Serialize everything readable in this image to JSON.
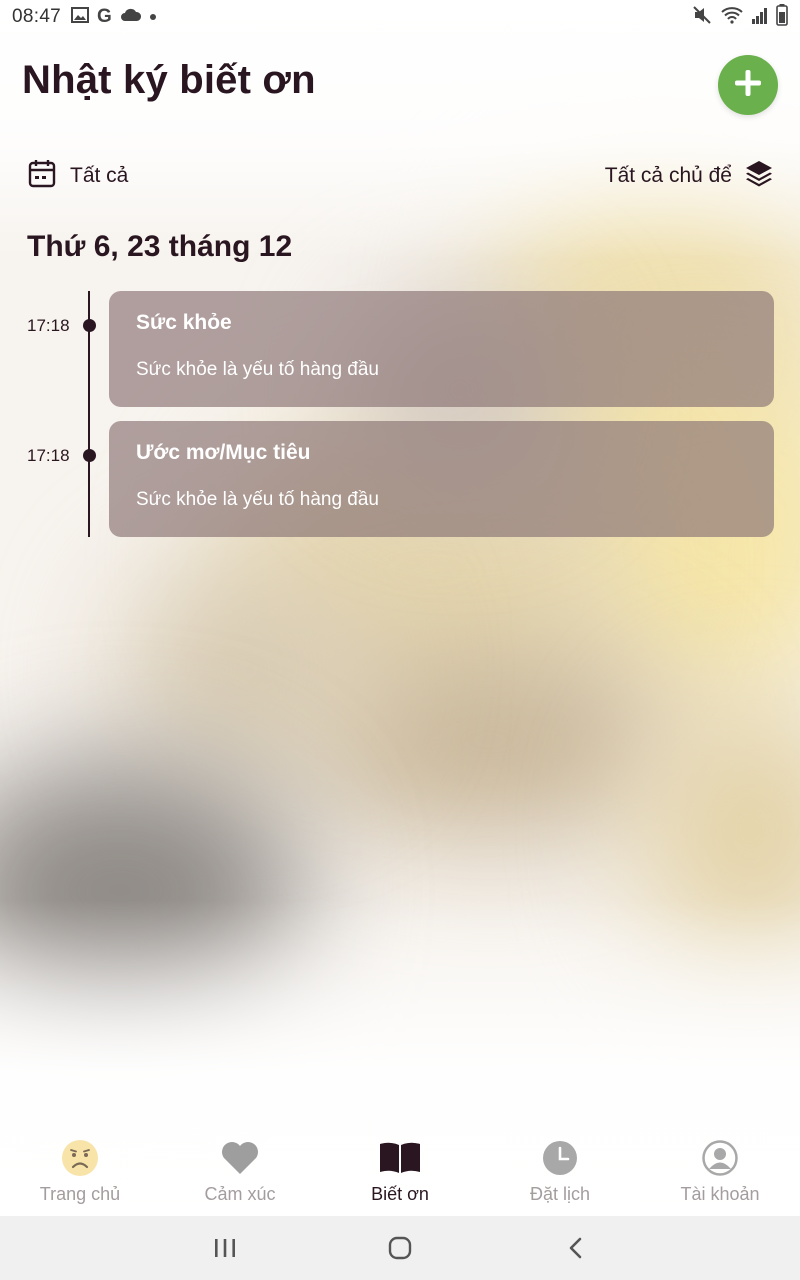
{
  "status_bar": {
    "time": "08:47",
    "left_icons": [
      "image-icon",
      "google-icon",
      "cloud-icon",
      "dot-icon"
    ],
    "right_icons": [
      "mute-icon",
      "wifi-icon",
      "signal-icon",
      "battery-icon"
    ],
    "google_glyph": "G"
  },
  "header": {
    "title": "Nhật ký biết ơn",
    "add_button_icon": "plus-icon",
    "accent_color": "#6ab04c"
  },
  "filters": {
    "date_filter_label": "Tất cả",
    "date_filter_icon": "calendar-icon",
    "topic_filter_label": "Tất cả chủ để",
    "topic_filter_icon": "layers-icon"
  },
  "day_heading": "Thứ 6, 23 tháng 12",
  "entries": [
    {
      "time": "17:18",
      "title": "Sức khỏe",
      "text": "Sức khỏe là yếu tố hàng đầu"
    },
    {
      "time": "17:18",
      "title": "Ước mơ/Mục tiêu",
      "text": "Sức khỏe là yếu tố hàng đầu"
    }
  ],
  "bottom_nav": [
    {
      "label": "Trang chủ",
      "icon": "sad-face-icon",
      "active": false
    },
    {
      "label": "Cảm xúc",
      "icon": "heart-icon",
      "active": false
    },
    {
      "label": "Biết ơn",
      "icon": "book-icon",
      "active": true
    },
    {
      "label": "Đặt lịch",
      "icon": "clock-icon",
      "active": false
    },
    {
      "label": "Tài khoản",
      "icon": "account-icon",
      "active": false
    }
  ],
  "system_nav": [
    "recent-apps-icon",
    "home-icon",
    "back-icon"
  ],
  "colors": {
    "text_dark": "#2a1620",
    "nav_inactive": "#a49d9d",
    "card_bg": "rgba(140,118,118,0.68)"
  }
}
